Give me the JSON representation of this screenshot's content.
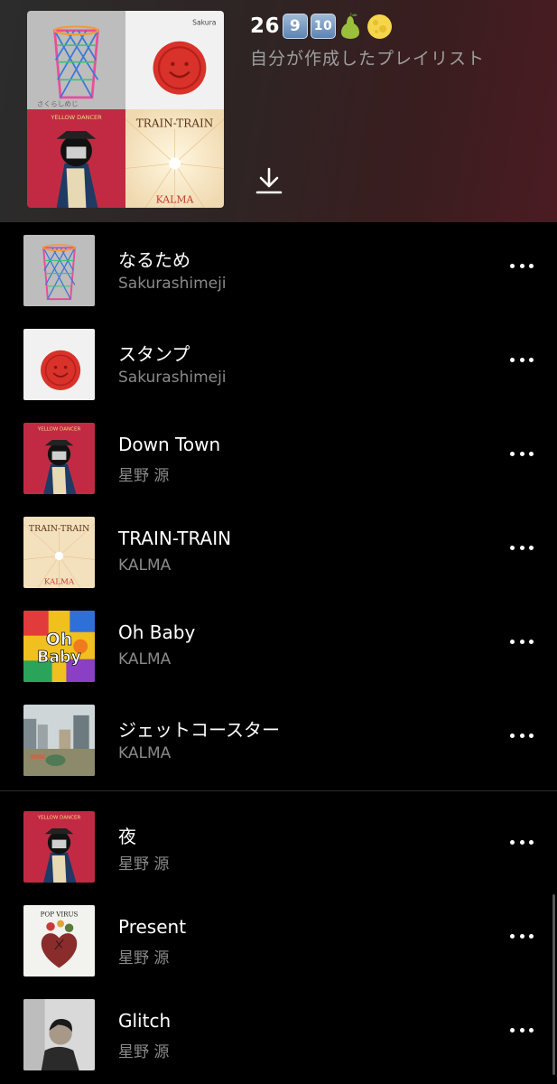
{
  "playlist": {
    "title_number": "26",
    "keycap_1": "9",
    "keycap_2": "10",
    "emoji_1": "pear",
    "emoji_2": "full-moon",
    "subtitle": "自分が作成したプレイリスト",
    "cover_albums": [
      "なるため",
      "スタンプ",
      "YELLOW DANCER",
      "TRAIN-TRAIN"
    ],
    "download_icon": "download-arrow-icon"
  },
  "tracks": [
    {
      "title": "なるため",
      "artist": "Sakurashimeji",
      "art": "trash-bin-art"
    },
    {
      "title": "スタンプ",
      "artist": "Sakurashimeji",
      "art": "red-seal-art"
    },
    {
      "title": "Down Town",
      "artist": "星野 源",
      "art": "yellow-dancer-art"
    },
    {
      "title": "TRAIN-TRAIN",
      "artist": "KALMA",
      "art": "train-train-art"
    },
    {
      "title": "Oh Baby",
      "artist": "KALMA",
      "art": "oh-baby-art"
    },
    {
      "title": "ジェットコースター",
      "artist": "KALMA",
      "art": "city-photo-art"
    },
    {
      "title": "夜",
      "artist": "星野 源",
      "art": "yellow-dancer-art"
    },
    {
      "title": "Present",
      "artist": "星野 源",
      "art": "pop-virus-art"
    },
    {
      "title": "Glitch",
      "artist": "星野 源",
      "art": "portrait-art"
    }
  ],
  "art_text": {
    "yellow_dancer": "YELLOW DANCER",
    "train_train": "TRAIN-TRAIN",
    "kalma": "KALMA",
    "oh_baby": "Oh Baby",
    "pop_virus": "POP VIRUS"
  },
  "colors": {
    "background": "#000000",
    "secondary_text": "#8a8a8a",
    "seal_red": "#d8322b",
    "yellow_dancer_red": "#c22a44"
  }
}
